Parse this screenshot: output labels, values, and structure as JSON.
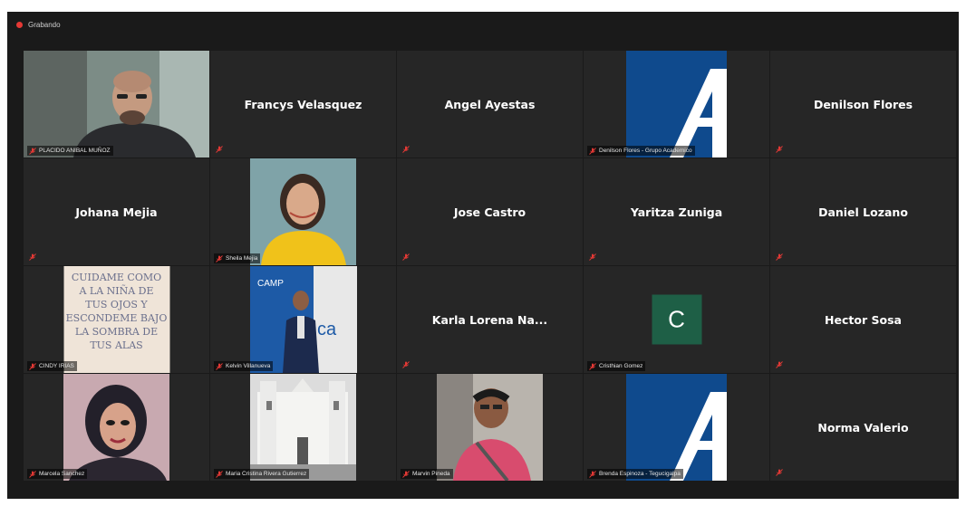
{
  "app": {
    "recording_label": "Grabando",
    "accent_color": "#b4d22e",
    "mute_color": "#e53935"
  },
  "tiles": [
    {
      "name": "",
      "label": "PLACIDO ANIBAL MUÑOZ",
      "type": "video-man"
    },
    {
      "name": "Francys Velasquez",
      "type": "name"
    },
    {
      "name": "Angel Ayestas",
      "type": "name"
    },
    {
      "name": "",
      "label": "Denilson Flores - Grupo Academico",
      "type": "logo"
    },
    {
      "name": "Denilson Flores",
      "type": "name"
    },
    {
      "name": "Johana Mejia",
      "type": "name"
    },
    {
      "name": "",
      "label": "Sheila Mejia",
      "type": "video-woman"
    },
    {
      "name": "Jose Castro",
      "type": "name"
    },
    {
      "name": "Yaritza Zuniga",
      "type": "name"
    },
    {
      "name": "Daniel Lozano",
      "type": "name"
    },
    {
      "name": "",
      "label": "CINDY IRIAS",
      "type": "sign",
      "sign_lines": [
        "CUIDAME COMO",
        "A LA NIÑA DE",
        "TUS OJOS Y",
        "ESCONDEME BAJO",
        "LA SOMBRA DE",
        "TUS ALAS"
      ]
    },
    {
      "name": "",
      "label": "Kelvin Villanueva",
      "type": "video-banner"
    },
    {
      "name": "Karla Lorena Na...",
      "type": "name"
    },
    {
      "name": "",
      "label": "Cristhian Gomez",
      "type": "initial",
      "initial": "C"
    },
    {
      "name": "Hector Sosa",
      "type": "name"
    },
    {
      "name": "",
      "label": "Marcela Sanchez",
      "type": "video-woman2"
    },
    {
      "name": "",
      "label": "Maria Cristina Rivera Gutierrez",
      "type": "church"
    },
    {
      "name": "",
      "label": "Marvin Pineda",
      "type": "video-car"
    },
    {
      "name": "",
      "label": "Brenda Espinoza - Tegucigalpa",
      "type": "logo"
    },
    {
      "name": "Norma Valerio",
      "type": "name"
    }
  ]
}
